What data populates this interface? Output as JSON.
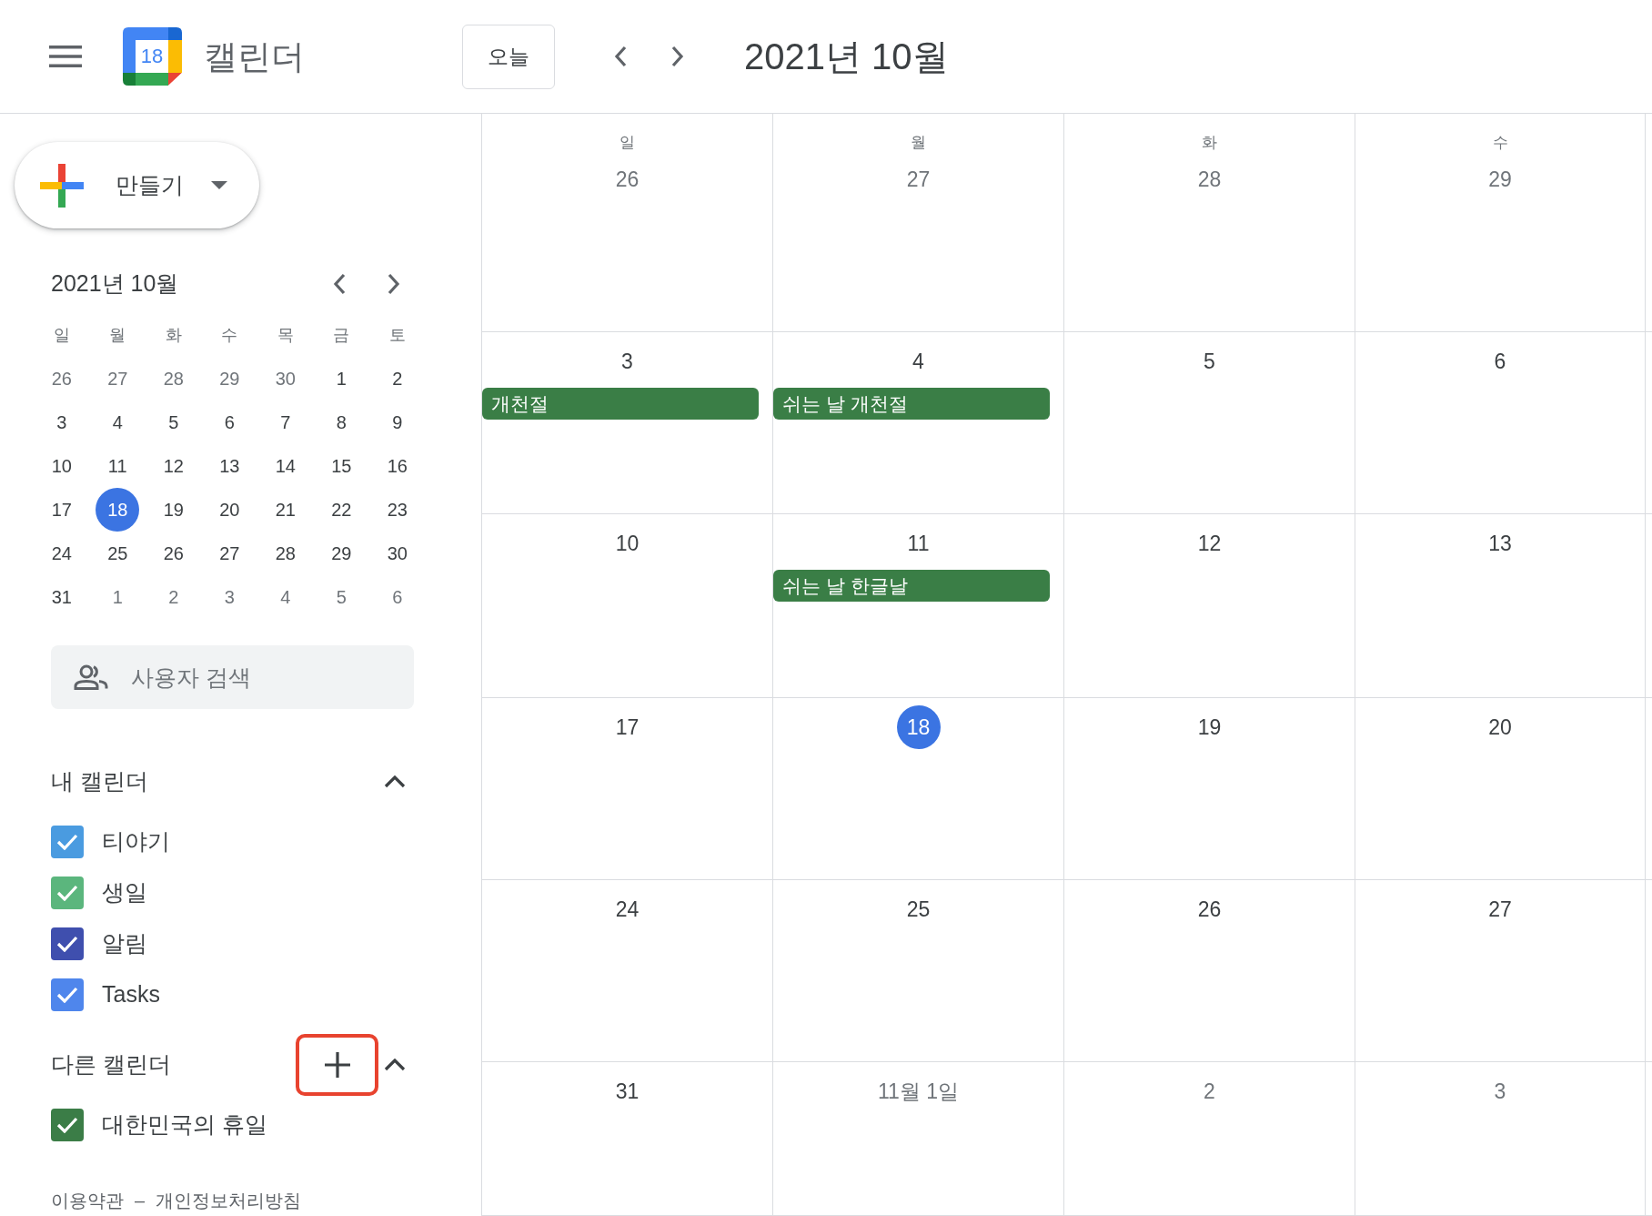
{
  "header": {
    "logo_date": "18",
    "app_name": "캘린더",
    "today_button": "오늘",
    "period_title": "2021년 10월"
  },
  "sidebar": {
    "create_button": "만들기",
    "mini_calendar": {
      "title": "2021년 10월",
      "weekdays": [
        "일",
        "월",
        "화",
        "수",
        "목",
        "금",
        "토"
      ],
      "weeks": [
        [
          {
            "day": "26",
            "in_month": false,
            "selected": false
          },
          {
            "day": "27",
            "in_month": false,
            "selected": false
          },
          {
            "day": "28",
            "in_month": false,
            "selected": false
          },
          {
            "day": "29",
            "in_month": false,
            "selected": false
          },
          {
            "day": "30",
            "in_month": false,
            "selected": false
          },
          {
            "day": "1",
            "in_month": true,
            "selected": false
          },
          {
            "day": "2",
            "in_month": true,
            "selected": false
          }
        ],
        [
          {
            "day": "3",
            "in_month": true,
            "selected": false
          },
          {
            "day": "4",
            "in_month": true,
            "selected": false
          },
          {
            "day": "5",
            "in_month": true,
            "selected": false
          },
          {
            "day": "6",
            "in_month": true,
            "selected": false
          },
          {
            "day": "7",
            "in_month": true,
            "selected": false
          },
          {
            "day": "8",
            "in_month": true,
            "selected": false
          },
          {
            "day": "9",
            "in_month": true,
            "selected": false
          }
        ],
        [
          {
            "day": "10",
            "in_month": true,
            "selected": false
          },
          {
            "day": "11",
            "in_month": true,
            "selected": false
          },
          {
            "day": "12",
            "in_month": true,
            "selected": false
          },
          {
            "day": "13",
            "in_month": true,
            "selected": false
          },
          {
            "day": "14",
            "in_month": true,
            "selected": false
          },
          {
            "day": "15",
            "in_month": true,
            "selected": false
          },
          {
            "day": "16",
            "in_month": true,
            "selected": false
          }
        ],
        [
          {
            "day": "17",
            "in_month": true,
            "selected": false
          },
          {
            "day": "18",
            "in_month": true,
            "selected": true
          },
          {
            "day": "19",
            "in_month": true,
            "selected": false
          },
          {
            "day": "20",
            "in_month": true,
            "selected": false
          },
          {
            "day": "21",
            "in_month": true,
            "selected": false
          },
          {
            "day": "22",
            "in_month": true,
            "selected": false
          },
          {
            "day": "23",
            "in_month": true,
            "selected": false
          }
        ],
        [
          {
            "day": "24",
            "in_month": true,
            "selected": false
          },
          {
            "day": "25",
            "in_month": true,
            "selected": false
          },
          {
            "day": "26",
            "in_month": true,
            "selected": false
          },
          {
            "day": "27",
            "in_month": true,
            "selected": false
          },
          {
            "day": "28",
            "in_month": true,
            "selected": false
          },
          {
            "day": "29",
            "in_month": true,
            "selected": false
          },
          {
            "day": "30",
            "in_month": true,
            "selected": false
          }
        ],
        [
          {
            "day": "31",
            "in_month": true,
            "selected": false
          },
          {
            "day": "1",
            "in_month": false,
            "selected": false
          },
          {
            "day": "2",
            "in_month": false,
            "selected": false
          },
          {
            "day": "3",
            "in_month": false,
            "selected": false
          },
          {
            "day": "4",
            "in_month": false,
            "selected": false
          },
          {
            "day": "5",
            "in_month": false,
            "selected": false
          },
          {
            "day": "6",
            "in_month": false,
            "selected": false
          }
        ]
      ]
    },
    "people_search": {
      "placeholder": "사용자 검색"
    },
    "sections": [
      {
        "title": "내 캘린더",
        "expanded": true,
        "items": [
          {
            "label": "티야기",
            "checked": true,
            "color": "#4a9be0"
          },
          {
            "label": "생일",
            "checked": true,
            "color": "#5bb67d"
          },
          {
            "label": "알림",
            "checked": true,
            "color": "#3f4fae"
          },
          {
            "label": "Tasks",
            "checked": true,
            "color": "#4f86ec"
          }
        ]
      },
      {
        "title": "다른 캘린더",
        "expanded": true,
        "add_button": {
          "highlighted": true
        },
        "items": [
          {
            "label": "대한민국의 휴일",
            "checked": true,
            "color": "#3b7d47"
          }
        ]
      }
    ],
    "footer": {
      "links": [
        "이용약관",
        "개인정보처리방침"
      ],
      "separator": "–"
    }
  },
  "month_view": {
    "weekdays": [
      "일",
      "월",
      "화",
      "수"
    ],
    "weeks": [
      [
        {
          "day": "26",
          "in_month": false,
          "today": false
        },
        {
          "day": "27",
          "in_month": false,
          "today": false
        },
        {
          "day": "28",
          "in_month": false,
          "today": false
        },
        {
          "day": "29",
          "in_month": false,
          "today": false
        }
      ],
      [
        {
          "day": "3",
          "in_month": true,
          "today": false,
          "events": [
            {
              "title": "개천절",
              "color": "#3a7e46"
            }
          ]
        },
        {
          "day": "4",
          "in_month": true,
          "today": false,
          "events": [
            {
              "title": "쉬는 날 개천절",
              "color": "#3a7e46"
            }
          ]
        },
        {
          "day": "5",
          "in_month": true,
          "today": false
        },
        {
          "day": "6",
          "in_month": true,
          "today": false
        }
      ],
      [
        {
          "day": "10",
          "in_month": true,
          "today": false
        },
        {
          "day": "11",
          "in_month": true,
          "today": false,
          "events": [
            {
              "title": "쉬는 날 한글날",
              "color": "#3a7e46"
            }
          ]
        },
        {
          "day": "12",
          "in_month": true,
          "today": false
        },
        {
          "day": "13",
          "in_month": true,
          "today": false
        }
      ],
      [
        {
          "day": "17",
          "in_month": true,
          "today": false
        },
        {
          "day": "18",
          "in_month": true,
          "today": true
        },
        {
          "day": "19",
          "in_month": true,
          "today": false
        },
        {
          "day": "20",
          "in_month": true,
          "today": false
        }
      ],
      [
        {
          "day": "24",
          "in_month": true,
          "today": false
        },
        {
          "day": "25",
          "in_month": true,
          "today": false
        },
        {
          "day": "26",
          "in_month": true,
          "today": false
        },
        {
          "day": "27",
          "in_month": true,
          "today": false
        }
      ],
      [
        {
          "day": "31",
          "in_month": true,
          "today": false
        },
        {
          "day": "11월 1일",
          "in_month": false,
          "today": false
        },
        {
          "day": "2",
          "in_month": false,
          "today": false
        },
        {
          "day": "3",
          "in_month": false,
          "today": false
        }
      ]
    ]
  }
}
